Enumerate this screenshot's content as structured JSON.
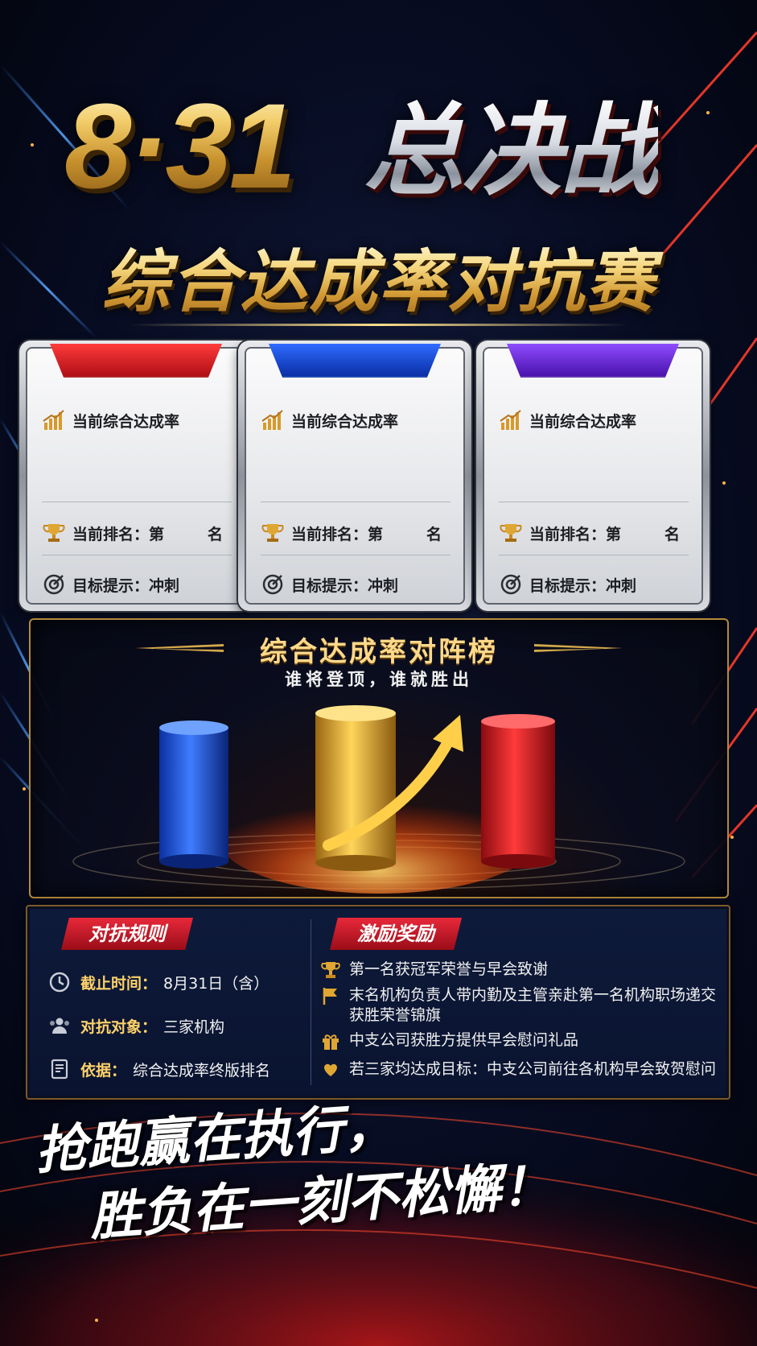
{
  "header": {
    "date": "8·31",
    "title": "总决战",
    "subtitle": "综合达成率对抗赛"
  },
  "cards": [
    {
      "team_color": "red",
      "rate_label": "当前综合达成率",
      "rank_label": "当前排名：第",
      "rank_unit": "名",
      "goal_label": "目标提示：冲刺"
    },
    {
      "team_color": "blue",
      "rate_label": "当前综合达成率",
      "rank_label": "当前排名：第",
      "rank_unit": "名",
      "goal_label": "目标提示：冲刺"
    },
    {
      "team_color": "purple",
      "rate_label": "当前综合达成率",
      "rank_label": "当前排名：第",
      "rank_unit": "名",
      "goal_label": "目标提示：冲刺"
    }
  ],
  "board": {
    "title": "综合达成率对阵榜",
    "subtitle": "谁将登顶，谁就胜出",
    "columns": [
      "blue",
      "gold",
      "red"
    ]
  },
  "rules": {
    "title": "对抗规则",
    "items": [
      {
        "icon": "clock-icon",
        "key": "截止时间：",
        "value": "8月31日（含）"
      },
      {
        "icon": "people-icon",
        "key": "对抗对象：",
        "value": "三家机构"
      },
      {
        "icon": "document-icon",
        "key": "依据：",
        "value": "综合达成率终版排名"
      }
    ]
  },
  "rewards": {
    "title": "激励奖励",
    "items": [
      {
        "icon": "trophy-icon",
        "text": "第一名获冠军荣誉与早会致谢"
      },
      {
        "icon": "flag-icon",
        "text": "末名机构负责人带内勤及主管亲赴第一名机构职场递交获胜荣誉锦旗"
      },
      {
        "icon": "gift-icon",
        "text": "中支公司获胜方提供早会慰问礼品"
      },
      {
        "icon": "heart-hand-icon",
        "text": "若三家均达成目标：中支公司前往各机构早会致贺慰问"
      }
    ]
  },
  "slogan": {
    "line1": "抢跑赢在执行，",
    "line2": "胜负在一刻不松懈！"
  },
  "colors": {
    "gold": "#f2cd6a",
    "red": "#d81e2a",
    "blue": "#1f56e0",
    "purple": "#6a2ad8",
    "navy": "#0a1430"
  }
}
